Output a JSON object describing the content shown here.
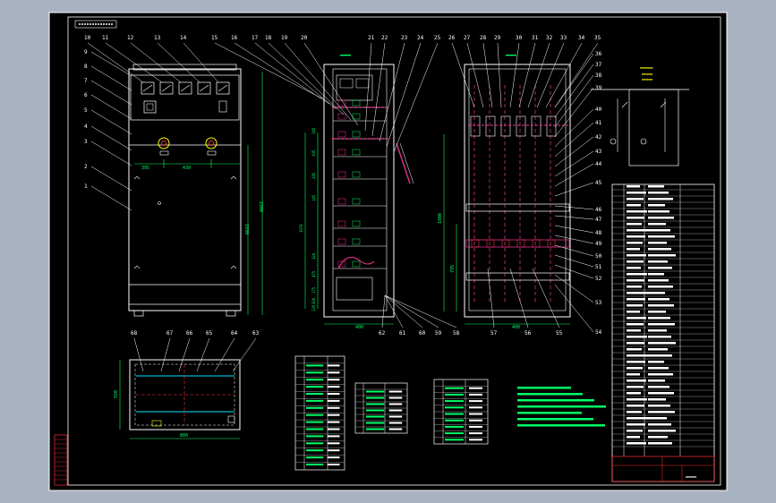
{
  "colors": {
    "viewport_bg": "#a8b2c1",
    "paper": "#000000",
    "line": "#ffffff",
    "dim": "#00ff66",
    "accent": "#ff3399",
    "cyan": "#00e5ff",
    "red": "#ff3030",
    "yellow": "#ffff00",
    "blue": "#4a6cff"
  },
  "front": {
    "callouts": [
      "10",
      "11",
      "12",
      "13",
      "14",
      "9",
      "8",
      "7",
      "6",
      "5",
      "4",
      "3",
      "2",
      "1"
    ],
    "dims": {
      "a": "395",
      "b": "430",
      "height_total": "2200",
      "height_inner": "1590"
    }
  },
  "side": {
    "callouts_top": [
      "15",
      "16",
      "17",
      "18",
      "19",
      "20",
      "21",
      "22",
      "23",
      "24",
      "25"
    ],
    "callouts_bottom": [
      "62",
      "61",
      "60",
      "59",
      "58"
    ],
    "dims": [
      "145",
      "195",
      "245",
      "145",
      "1970",
      "320",
      "475",
      "175",
      "300",
      "135"
    ],
    "width": "400"
  },
  "rear": {
    "callouts_top": [
      "26",
      "27",
      "28",
      "29",
      "30",
      "31",
      "32",
      "33",
      "34",
      "35"
    ],
    "callouts_right": [
      "36",
      "37",
      "38",
      "39",
      "40",
      "41",
      "42",
      "43",
      "44",
      "45",
      "46",
      "47",
      "48",
      "49",
      "50",
      "51",
      "52",
      "53",
      "54"
    ],
    "callouts_bottom": [
      "57",
      "56",
      "55"
    ],
    "dims": [
      "1800",
      "795",
      "400"
    ]
  },
  "plan": {
    "callouts": [
      "68",
      "67",
      "66",
      "65",
      "64",
      "63"
    ],
    "depth": "550",
    "width": "800"
  },
  "table_a": {
    "rows": 16
  },
  "table_b": {
    "rows": 8
  },
  "table_c": {
    "rows": 10
  },
  "bom": {
    "rows": 42
  }
}
